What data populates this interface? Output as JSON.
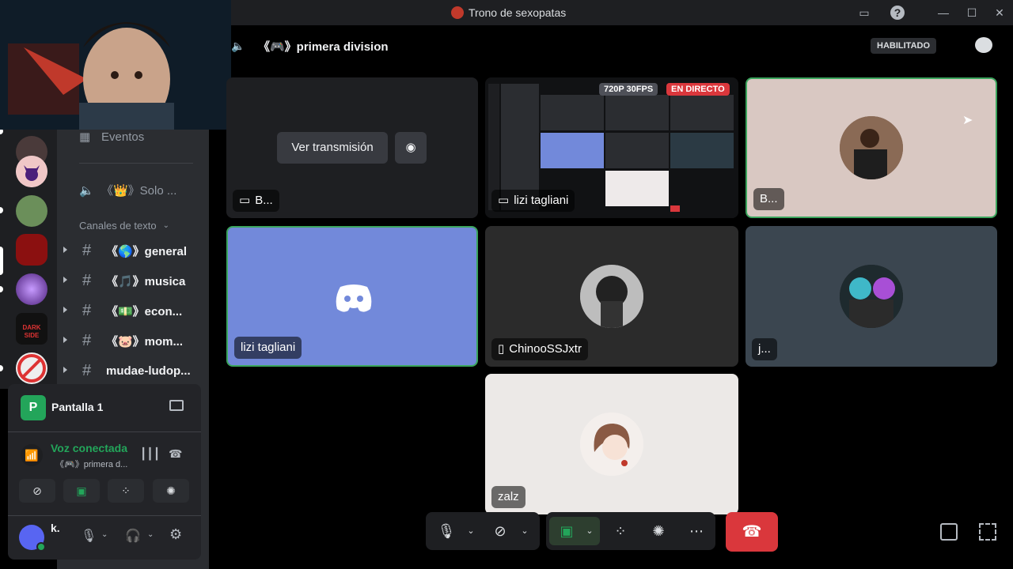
{
  "window": {
    "title": "Trono de sexopatas"
  },
  "sidebar": {
    "events_label": "Eventos",
    "voice_channel_other": "《👑》Solo ...",
    "text_category": "Canales de texto",
    "text_channels": [
      {
        "name": "《🌎》general"
      },
      {
        "name": "《🎵》musica"
      },
      {
        "name": "《💵》econ..."
      },
      {
        "name": "《🐷》mom..."
      },
      {
        "name": "mudae-ludop..."
      }
    ],
    "dark_side_label": "DARK SIDE"
  },
  "voice_panel": {
    "stream_title": "Pantalla 1",
    "stream_icon_letter": "P",
    "status": "Voz conectada",
    "channel": "《🎮》primera d...",
    "user_name": "k."
  },
  "header": {
    "channel_title": "《🎮》primera division",
    "badge": "HABILITADO"
  },
  "tiles": {
    "t1": {
      "name": "B...",
      "button_watch": "Ver transmisión"
    },
    "t2": {
      "name": "lizi tagliani",
      "badge_quality": "720P 30FPS",
      "badge_live": "EN DIRECTO"
    },
    "t3": {
      "name": "B..."
    },
    "t4": {
      "name": "lizi tagliani"
    },
    "t5": {
      "name": "ChinooSSJxtr"
    },
    "t6": {
      "name": "j..."
    },
    "t7": {
      "name": "zalz"
    }
  },
  "colors": {
    "accent_green": "#3ba55d",
    "blurple": "#7289da",
    "hangup_red": "#da373c"
  }
}
